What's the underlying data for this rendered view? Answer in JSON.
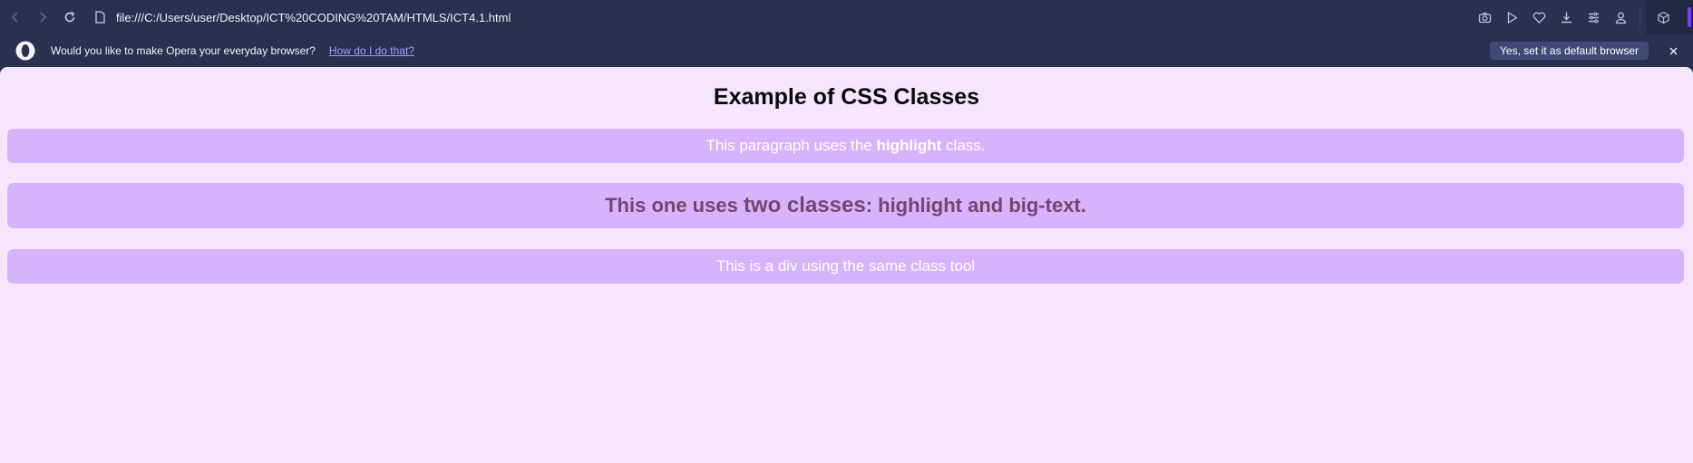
{
  "browser": {
    "url": "file:///C:/Users/user/Desktop/ICT%20CODING%20TAM/HTMLS/ICT4.1.html",
    "icons": [
      "back-icon",
      "forward-icon",
      "reload-icon",
      "file-icon",
      "camera-icon",
      "play-icon",
      "heart-icon",
      "download-icon",
      "menu-icon",
      "profile-icon",
      "extensions-icon"
    ]
  },
  "infobar": {
    "message": "Would you like to make Opera your everyday browser?",
    "link": "How do I do that?",
    "button": "Yes, set it as default browser"
  },
  "page": {
    "title": "Example of CSS Classes",
    "p1_before": "This paragraph uses the ",
    "p1_bold": "highlight",
    "p1_after": " class.",
    "p2_before": "This one uses ",
    "p2_bold": "two classes",
    "p2_after": ": highlight and big-text.",
    "div_text": "This is a div using the same class tool"
  },
  "colors": {
    "chrome": "#2b3050",
    "page_bg": "#f5e6fe",
    "highlight_bg": "#d7b3fb",
    "big_text": "#74456f",
    "link": "#a99bff"
  }
}
